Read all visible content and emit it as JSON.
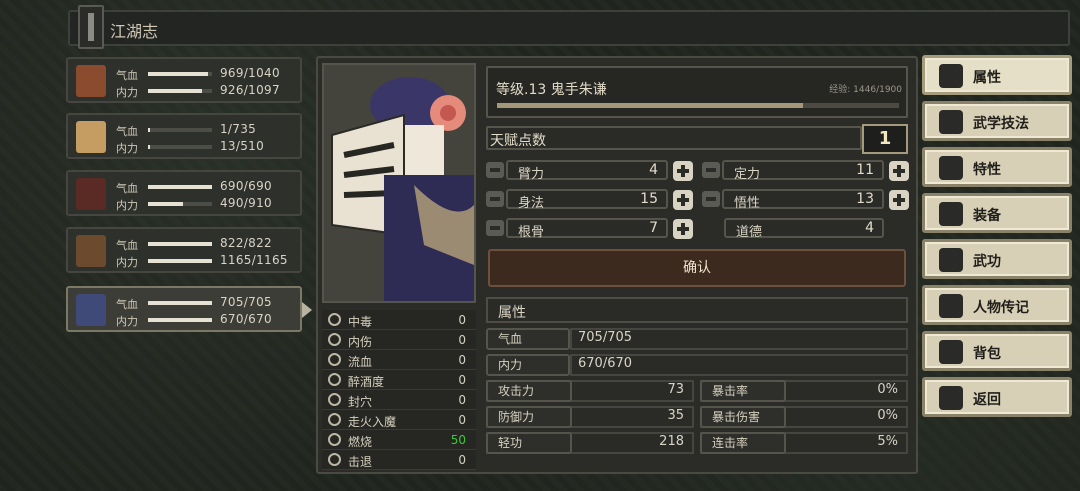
{
  "header": {
    "title": "江湖志"
  },
  "roster": [
    {
      "hp_label": "气血",
      "hp": "969/1040",
      "hp_ratio": 0.93,
      "mp_label": "内力",
      "mp": "926/1097",
      "mp_ratio": 0.84,
      "avatar_color": "#8a4b2f"
    },
    {
      "hp_label": "气血",
      "hp": "1/735",
      "hp_ratio": 0.01,
      "mp_label": "内力",
      "mp": "13/510",
      "mp_ratio": 0.03,
      "avatar_color": "#c59c62"
    },
    {
      "hp_label": "气血",
      "hp": "690/690",
      "hp_ratio": 1.0,
      "mp_label": "内力",
      "mp": "490/910",
      "mp_ratio": 0.54,
      "avatar_color": "#5a2a25"
    },
    {
      "hp_label": "气血",
      "hp": "822/822",
      "hp_ratio": 1.0,
      "mp_label": "内力",
      "mp": "1165/1165",
      "mp_ratio": 1.0,
      "avatar_color": "#6b4a2e"
    },
    {
      "hp_label": "气血",
      "hp": "705/705",
      "hp_ratio": 1.0,
      "mp_label": "内力",
      "mp": "670/670",
      "mp_ratio": 1.0,
      "avatar_color": "#3f4a78",
      "selected": true
    }
  ],
  "status_effects": [
    {
      "label": "中毒",
      "value": "0"
    },
    {
      "label": "内伤",
      "value": "0"
    },
    {
      "label": "流血",
      "value": "0"
    },
    {
      "label": "醉酒度",
      "value": "0"
    },
    {
      "label": "封穴",
      "value": "0"
    },
    {
      "label": "走火入魔",
      "value": "0"
    },
    {
      "label": "燃烧",
      "value": "50",
      "highlight": true
    },
    {
      "label": "击退",
      "value": "0"
    }
  ],
  "character": {
    "level_text": "等级.13  鬼手朱谦",
    "exp_text": "经验: 1446/1900",
    "exp_ratio": 0.761
  },
  "talent": {
    "label": "天赋点数",
    "points": "1"
  },
  "attributes": [
    {
      "label": "臂力",
      "value": "4",
      "has_minus": true,
      "has_plus": true
    },
    {
      "label": "定力",
      "value": "11",
      "has_minus": true,
      "has_plus": true
    },
    {
      "label": "身法",
      "value": "15",
      "has_minus": true,
      "has_plus": true
    },
    {
      "label": "悟性",
      "value": "13",
      "has_minus": true,
      "has_plus": true
    },
    {
      "label": "根骨",
      "value": "7",
      "has_minus": true,
      "has_plus": true
    },
    {
      "label": "道德",
      "value": "4",
      "has_minus": false,
      "has_plus": false
    }
  ],
  "confirm_label": "确认",
  "properties": {
    "section_title": "属性",
    "hp_label": "气血",
    "hp": "705/705",
    "mp_label": "内力",
    "mp": "670/670",
    "stats": [
      {
        "label": "攻击力",
        "value": "73"
      },
      {
        "label": "暴击率",
        "value": "0%"
      },
      {
        "label": "防御力",
        "value": "35"
      },
      {
        "label": "暴击伤害",
        "value": "0%"
      },
      {
        "label": "轻功",
        "value": "218"
      },
      {
        "label": "连击率",
        "value": "5%"
      }
    ]
  },
  "menu": [
    {
      "label": "属性",
      "icon": "person-icon",
      "active": true
    },
    {
      "label": "武学技法",
      "icon": "martial-skill-icon"
    },
    {
      "label": "特性",
      "icon": "trait-icon"
    },
    {
      "label": "装备",
      "icon": "sword-icon"
    },
    {
      "label": "武功",
      "icon": "book-icon"
    },
    {
      "label": "人物传记",
      "icon": "biography-icon"
    },
    {
      "label": "背包",
      "icon": "bag-icon"
    },
    {
      "label": "返回",
      "icon": "door-icon"
    }
  ]
}
